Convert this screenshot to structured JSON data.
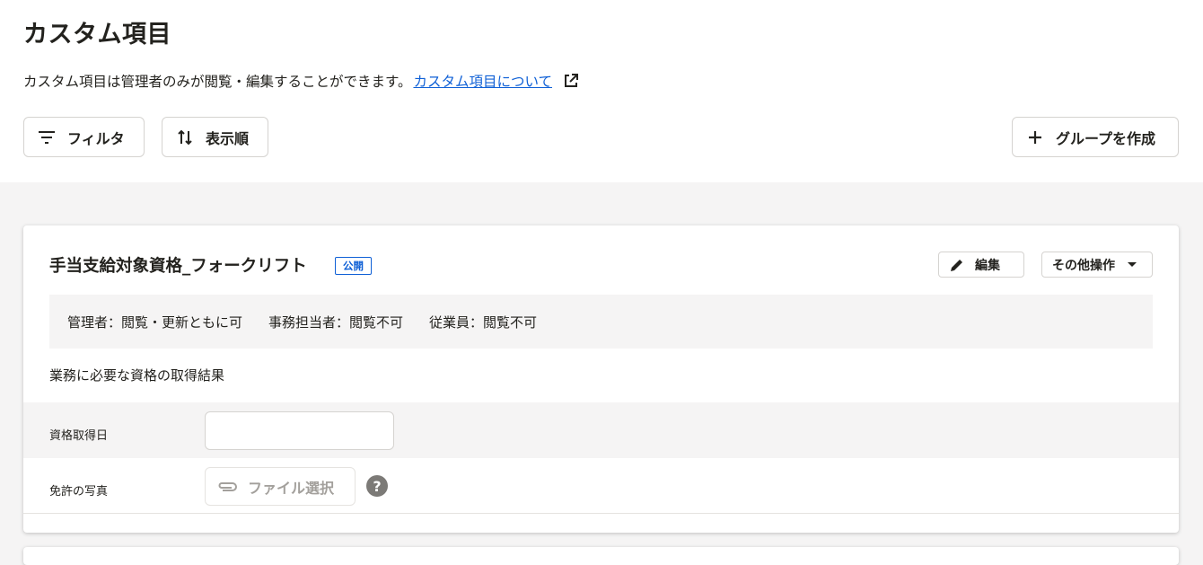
{
  "header": {
    "title": "カスタム項目",
    "description": "カスタム項目は管理者のみが閲覧・編集することができます。",
    "help_link": "カスタム項目について"
  },
  "toolbar": {
    "filter_label": "フィルタ",
    "sort_label": "表示順",
    "create_group_label": "グループを作成"
  },
  "group": {
    "title": "手当支給対象資格_フォークリフト",
    "badge": "公開",
    "edit_label": "編集",
    "more_label": "その他操作",
    "permissions": [
      "管理者：閲覧・更新ともに可",
      "事務担当者：閲覧不可",
      "従業員：閲覧不可"
    ],
    "description": "業務に必要な資格の取得結果",
    "fields": [
      {
        "label": "資格取得日",
        "value": ""
      },
      {
        "label": "免許の写真",
        "button_label": "ファイル選択"
      }
    ]
  },
  "colors": {
    "accent": "#0f60d6",
    "text": "#23221e",
    "bg": "#f5f4f4"
  },
  "icons": [
    "filter-icon",
    "sort-icon",
    "external-link-icon",
    "plus-icon",
    "pencil-icon",
    "caret-down-icon",
    "paperclip-icon",
    "help-icon"
  ]
}
